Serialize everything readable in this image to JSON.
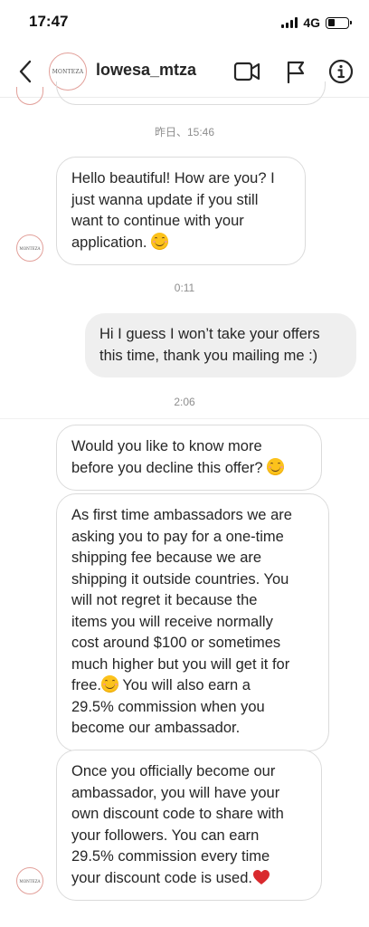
{
  "status_bar": {
    "time": "17:47",
    "network": "4G"
  },
  "header": {
    "username": "lowesa_mtza",
    "avatar_text": "MONTEZA"
  },
  "messages": {
    "ts1": "昨日、15:46",
    "msg1": {
      "lines": [
        "Hello beautiful! How are you? I",
        "just wanna update if you still",
        "want to continue with your",
        "application."
      ],
      "emoji": "smiling-face-emoji"
    },
    "ts2": "0:11",
    "msg2": {
      "lines": [
        "Hi I guess I won’t take your offers",
        "this time, thank you mailing me :)"
      ]
    },
    "ts3": "2:06",
    "msg3": {
      "lines": [
        "Would you like to know more",
        "before you decline this offer?"
      ],
      "emoji": "smiling-face-emoji"
    },
    "msg4": {
      "lines": [
        "As first time ambassadors we are",
        "asking you to pay for a one-time",
        "shipping fee because we are",
        "shipping it outside countries. You",
        "will not regret it because the",
        "items you will receive normally",
        "cost around $100 or sometimes",
        "much higher but you will get it for",
        "free.",
        " You will also earn a",
        "29.5% commission when you",
        "become our ambassador."
      ],
      "emoji": "smiling-face-emoji"
    },
    "msg5": {
      "lines": [
        "Once you officially become our",
        "ambassador, you will have your",
        "own discount code to share with",
        "your followers. You can earn",
        "29.5% commission every time",
        "your discount code is used."
      ],
      "emoji": "red-heart-emoji"
    }
  },
  "colors": {
    "avatar_ring": "#e2a09a",
    "outgoing_bubble": "#efefef",
    "incoming_border": "#dbdbdb",
    "timestamp": "#8e8e8e"
  }
}
